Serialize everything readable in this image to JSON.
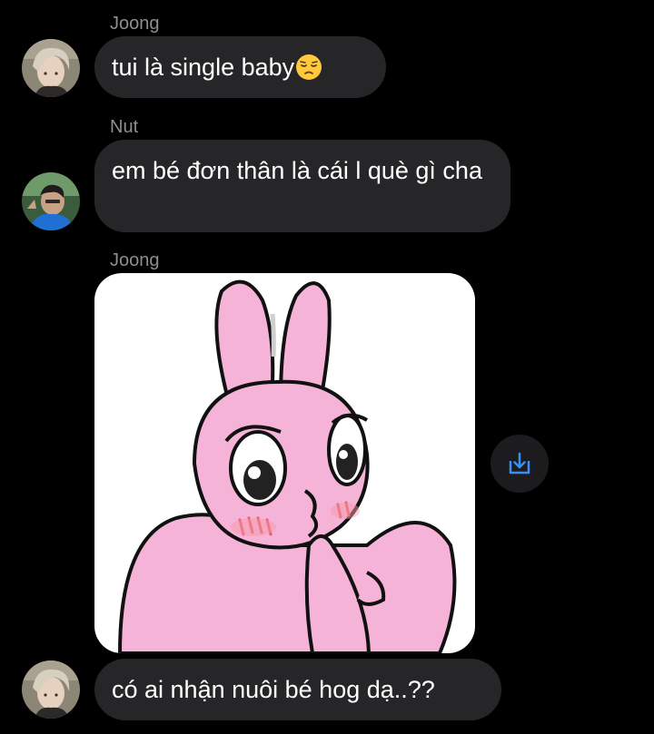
{
  "messages": [
    {
      "sender": "Joong",
      "text": "tui là single baby"
    },
    {
      "sender": "Nut",
      "text": "em bé đơn thân là cái l què gì cha"
    },
    {
      "sender": "Joong"
    },
    {
      "text": "có ai nhận nuôi bé hog dạ..??"
    }
  ],
  "icons": {
    "emoji": "pensive-face-icon",
    "save": "save-download-icon"
  },
  "colors": {
    "background": "#000000",
    "bubble": "#262628",
    "sender_name": "#8e8e93",
    "accent": "#3a8ef6",
    "sticker_pink": "#f5b3d8"
  }
}
